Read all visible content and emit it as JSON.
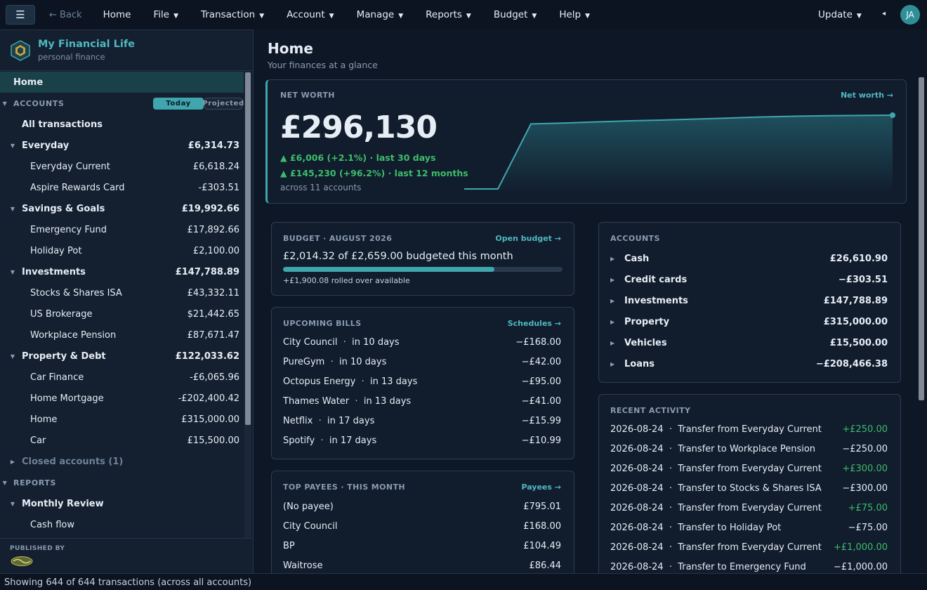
{
  "topbar": {
    "menu_icon": "hamburger-icon",
    "back": "← Back",
    "menu": [
      "Home",
      "File",
      "Transaction",
      "Account",
      "Manage",
      "Reports",
      "Budget",
      "Help"
    ],
    "dropdown_menus": [
      false,
      true,
      true,
      true,
      true,
      true,
      true,
      true
    ],
    "update": "Update",
    "avatar": "JA"
  },
  "sidebar": {
    "brand_title": "My Financial Life",
    "brand_sub": "personal finance",
    "home": "Home",
    "accounts_label": "ACCOUNTS",
    "toggle_today": "Today",
    "toggle_projected": "Projected",
    "all_transactions": "All transactions",
    "groups": [
      {
        "name": "Everyday",
        "amount": "£6,314.73",
        "items": [
          {
            "name": "Everyday Current",
            "amount": "£6,618.24"
          },
          {
            "name": "Aspire Rewards Card",
            "amount": "-£303.51"
          }
        ]
      },
      {
        "name": "Savings & Goals",
        "amount": "£19,992.66",
        "items": [
          {
            "name": "Emergency Fund",
            "amount": "£17,892.66"
          },
          {
            "name": "Holiday Pot",
            "amount": "£2,100.00"
          }
        ]
      },
      {
        "name": "Investments",
        "amount": "£147,788.89",
        "items": [
          {
            "name": "Stocks & Shares ISA",
            "amount": "£43,332.11"
          },
          {
            "name": "US Brokerage",
            "amount": "$21,442.65"
          },
          {
            "name": "Workplace Pension",
            "amount": "£87,671.47"
          }
        ]
      },
      {
        "name": "Property & Debt",
        "amount": "£122,033.62",
        "items": [
          {
            "name": "Car Finance",
            "amount": "-£6,065.96"
          },
          {
            "name": "Home Mortgage",
            "amount": "-£202,400.42"
          },
          {
            "name": "Home",
            "amount": "£315,000.00"
          },
          {
            "name": "Car",
            "amount": "£15,500.00"
          }
        ]
      }
    ],
    "closed_accounts": "Closed accounts (1)",
    "reports_label": "REPORTS",
    "reports_group": "Monthly Review",
    "reports_items": [
      "Cash flow"
    ],
    "published_by": "PUBLISHED BY"
  },
  "status": "Showing 644 of 644 transactions  (across all accounts)",
  "main": {
    "title": "Home",
    "subtitle": "Your finances at a glance",
    "net_worth": {
      "label": "NET WORTH",
      "link": "Net worth →",
      "value": "£296,130",
      "gain_30": "▲ £6,006 (+2.1%) · last 30 days",
      "gain_12": "▲ £145,230 (+96.2%) · last 12 months",
      "across": "across 11 accounts",
      "sparkline": [
        150900,
        150900,
        279000,
        280500,
        283000,
        285000,
        286500,
        288500,
        290500,
        292500,
        294000,
        295200,
        296130
      ]
    },
    "budget": {
      "label": "BUDGET · AUGUST 2026",
      "link": "Open budget →",
      "summary": "£2,014.32 of £2,659.00 budgeted this month",
      "progress": 0.757,
      "rollover": "+£1,900.08 rolled over available"
    },
    "bills": {
      "label": "UPCOMING BILLS",
      "link": "Schedules →",
      "items": [
        {
          "name": "City Council",
          "due": "in 10 days",
          "amount": "−£168.00"
        },
        {
          "name": "PureGym",
          "due": "in 10 days",
          "amount": "−£42.00"
        },
        {
          "name": "Octopus Energy",
          "due": "in 13 days",
          "amount": "−£95.00"
        },
        {
          "name": "Thames Water",
          "due": "in 13 days",
          "amount": "−£41.00"
        },
        {
          "name": "Netflix",
          "due": "in 17 days",
          "amount": "−£15.99"
        },
        {
          "name": "Spotify",
          "due": "in 17 days",
          "amount": "−£10.99"
        }
      ]
    },
    "payees": {
      "label": "TOP PAYEES · THIS MONTH",
      "link": "Payees →",
      "items": [
        {
          "name": "(No payee)",
          "amount": "£795.01"
        },
        {
          "name": "City Council",
          "amount": "£168.00"
        },
        {
          "name": "BP",
          "amount": "£104.49"
        },
        {
          "name": "Waitrose",
          "amount": "£86.44"
        }
      ]
    },
    "accounts": {
      "label": "ACCOUNTS",
      "items": [
        {
          "name": "Cash",
          "amount": "£26,610.90"
        },
        {
          "name": "Credit cards",
          "amount": "−£303.51"
        },
        {
          "name": "Investments",
          "amount": "£147,788.89"
        },
        {
          "name": "Property",
          "amount": "£315,000.00"
        },
        {
          "name": "Vehicles",
          "amount": "£15,500.00"
        },
        {
          "name": "Loans",
          "amount": "−£208,466.38"
        }
      ]
    },
    "activity": {
      "label": "RECENT ACTIVITY",
      "items": [
        {
          "date": "2026-08-24",
          "desc": "Transfer from Everyday Current",
          "amount": "+£250.00",
          "pos": true
        },
        {
          "date": "2026-08-24",
          "desc": "Transfer to Workplace Pension",
          "amount": "−£250.00",
          "pos": false
        },
        {
          "date": "2026-08-24",
          "desc": "Transfer from Everyday Current",
          "amount": "+£300.00",
          "pos": true
        },
        {
          "date": "2026-08-24",
          "desc": "Transfer to Stocks & Shares ISA",
          "amount": "−£300.00",
          "pos": false
        },
        {
          "date": "2026-08-24",
          "desc": "Transfer from Everyday Current",
          "amount": "+£75.00",
          "pos": true
        },
        {
          "date": "2026-08-24",
          "desc": "Transfer to Holiday Pot",
          "amount": "−£75.00",
          "pos": false
        },
        {
          "date": "2026-08-24",
          "desc": "Transfer from Everyday Current",
          "amount": "+£1,000.00",
          "pos": true
        },
        {
          "date": "2026-08-24",
          "desc": "Transfer to Emergency Fund",
          "amount": "−£1,000.00",
          "pos": false
        }
      ]
    }
  }
}
